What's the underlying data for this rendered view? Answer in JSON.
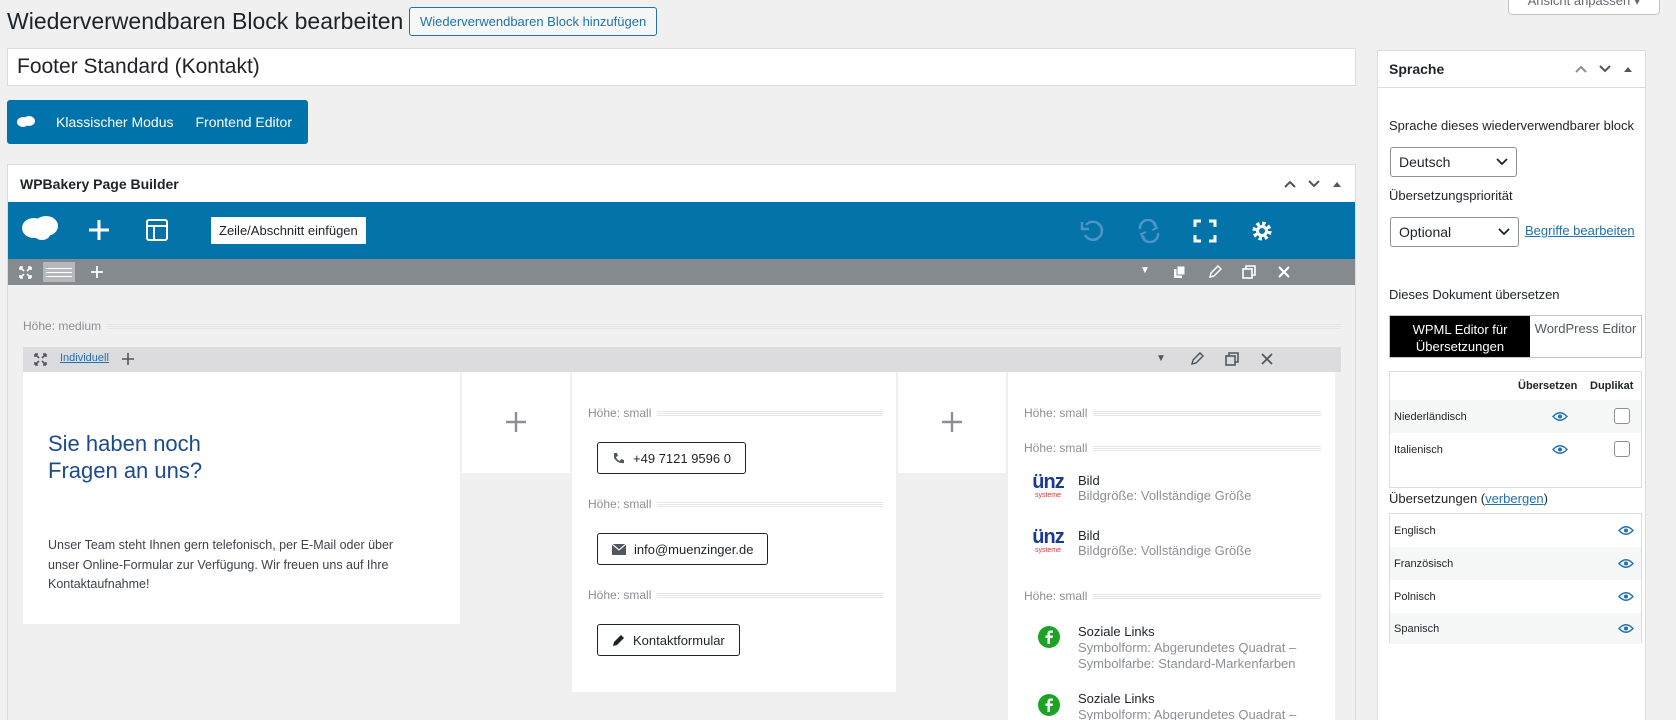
{
  "header": {
    "title": "Wiederverwendbaren Block bearbeiten",
    "add_button": "Wiederverwendbaren Block hinzufügen",
    "screen_options": "Ansicht anpassen"
  },
  "post_title": "Footer Standard (Kontakt)",
  "mode_bar": {
    "classic": "Klassischer Modus",
    "frontend": "Frontend Editor"
  },
  "builder": {
    "title": "WPBakery Page Builder",
    "insert_row": "Zeile/Abschnitt einfügen",
    "height_medium": "Höhe: medium",
    "custom_link": "Individuell",
    "height_small": "Höhe: small",
    "col1": {
      "heading_line1": "Sie haben noch",
      "heading_line2": "Fragen an uns?",
      "text": "Unser Team steht Ihnen gern telefonisch, per E-Mail oder über unser Online-Formular zur Verfügung. Wir freuen uns auf Ihre Kontaktaufnahme!"
    },
    "buttons": {
      "phone": "+49 7121 9596 0",
      "email": "info@muenzinger.de",
      "form": "Kontaktformular"
    },
    "image_title": "Bild",
    "image_size": "Bildgröße: Vollständige Größe",
    "logo_text": "ünz",
    "logo_sub": "systeme",
    "social_title": "Soziale Links",
    "social_desc1": "Symbolform: Abgerundetes Quadrat –",
    "social_desc2": "Symbolfarbe: Standard-Markenfarben",
    "social_desc3": "Symbolform: Abgerundetes Quadrat –"
  },
  "sidebar": {
    "title": "Sprache",
    "lang_label": "Sprache dieses wiederverwendbarer block",
    "lang_value": "Deutsch",
    "priority_label": "Übersetzungspriorität",
    "priority_value": "Optional",
    "terms_link": "Begriffe bearbeiten",
    "translate_doc": "Dieses Dokument übersetzen",
    "wpml_editor": "WPML Editor für Übersetzungen",
    "wp_editor": "WordPress Editor",
    "col_translate": "Übersetzen",
    "col_duplicate": "Duplikat",
    "lang_rows": [
      "Niederländisch",
      "Italienisch"
    ],
    "translations_label": "Übersetzungen (",
    "hide_link": "verbergen",
    "translations_close": ")",
    "translations": [
      "Englisch",
      "Französisch",
      "Polnisch",
      "Spanisch"
    ]
  }
}
